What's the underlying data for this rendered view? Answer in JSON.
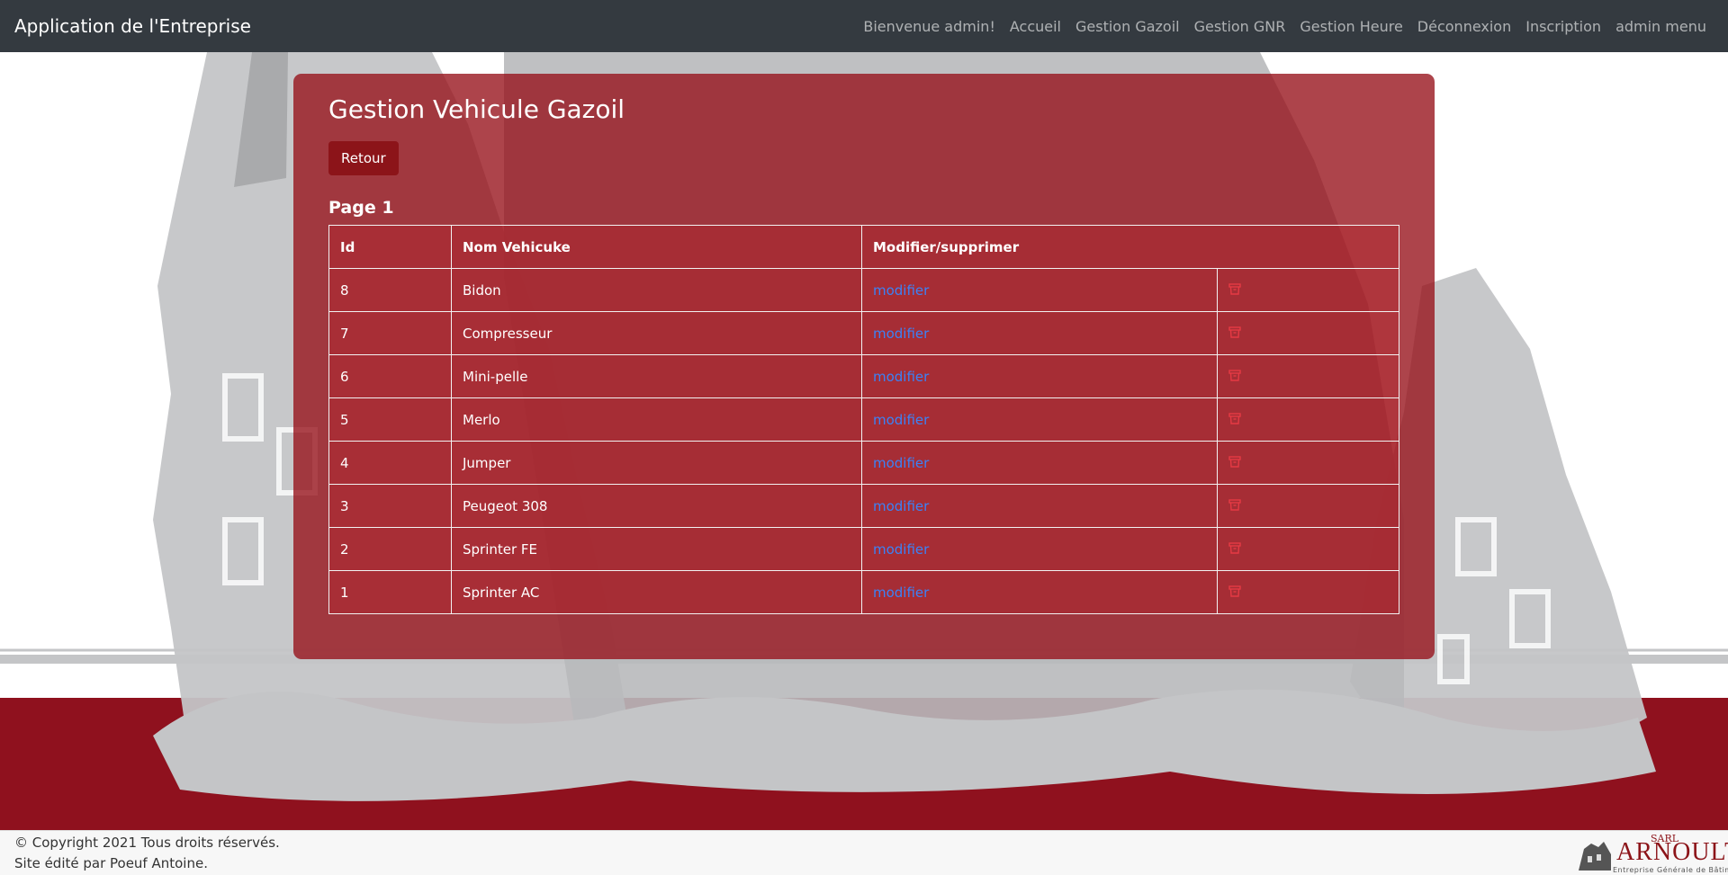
{
  "navbar": {
    "brand": "Application de l'Entreprise",
    "links": [
      {
        "label": "Bienvenue admin!"
      },
      {
        "label": "Accueil"
      },
      {
        "label": "Gestion Gazoil"
      },
      {
        "label": "Gestion GNR"
      },
      {
        "label": "Gestion Heure"
      },
      {
        "label": "Déconnexion"
      },
      {
        "label": "Inscription"
      },
      {
        "label": "admin menu"
      }
    ]
  },
  "main": {
    "title": "Gestion Vehicule Gazoil",
    "back_label": "Retour",
    "page_label": "Page 1",
    "table": {
      "headers": [
        "Id",
        "Nom Vehicuke",
        "Modifier/supprimer"
      ],
      "rows": [
        {
          "id": "8",
          "name": "Bidon",
          "edit": "modifier"
        },
        {
          "id": "7",
          "name": "Compresseur",
          "edit": "modifier"
        },
        {
          "id": "6",
          "name": "Mini-pelle",
          "edit": "modifier"
        },
        {
          "id": "5",
          "name": "Merlo",
          "edit": "modifier"
        },
        {
          "id": "4",
          "name": "Jumper",
          "edit": "modifier"
        },
        {
          "id": "3",
          "name": "Peugeot 308",
          "edit": "modifier"
        },
        {
          "id": "2",
          "name": "Sprinter FE",
          "edit": "modifier"
        },
        {
          "id": "1",
          "name": "Sprinter AC",
          "edit": "modifier"
        }
      ],
      "delete_icon": "trash-icon"
    }
  },
  "footer": {
    "copyright": "© Copyright 2021 Tous droits réservés.",
    "credit": "Site édité par Poeuf Antoine."
  },
  "logo": {
    "sarl": "SARL",
    "name": "ARNOULT",
    "subtitle": "Entreprise Générale de Bâtiment"
  },
  "colors": {
    "navbar": "#343a40",
    "card": "#961018",
    "band": "#8f111e",
    "link": "#3b82f6",
    "art": "#c4c5c7"
  }
}
